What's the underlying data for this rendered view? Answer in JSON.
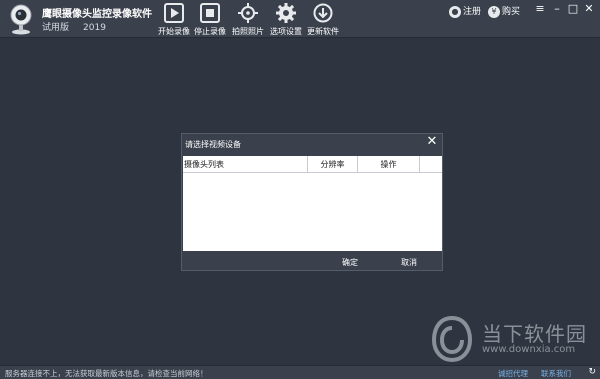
{
  "app": {
    "title": "鹰眼摄像头监控录像软件",
    "edition": "试用版",
    "year": "2019"
  },
  "toolbar": [
    {
      "label": "开始录像",
      "icon": "play-icon"
    },
    {
      "label": "停止录像",
      "icon": "stop-icon"
    },
    {
      "label": "拍照照片",
      "icon": "crosshair-icon"
    },
    {
      "label": "选项设置",
      "icon": "gear-icon"
    },
    {
      "label": "更新软件",
      "icon": "download-icon"
    }
  ],
  "top_right": {
    "register": "注册",
    "buy": "购买"
  },
  "dialog": {
    "title": "请选择视频设备",
    "columns": [
      "摄像头列表",
      "分辨率",
      "操作"
    ],
    "ok": "确定",
    "cancel": "取消"
  },
  "statusbar": {
    "message": "服务器连接不上，无法获取最新版本信息，请检查当前网络！",
    "agent_link": "诚招代理",
    "contact_link": "联系我们"
  },
  "watermark": {
    "brand": "当下软件园",
    "url": "www.downxia.com"
  },
  "colors": {
    "background": "#2f3540",
    "toolbar": "#3a414c",
    "link": "#7ab0e6"
  }
}
